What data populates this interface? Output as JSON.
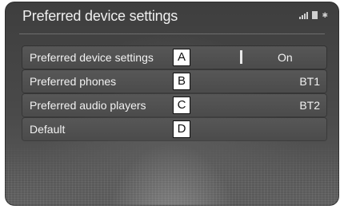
{
  "screen": {
    "title": "Preferred device settings"
  },
  "status_bar": {
    "icons": [
      "signal-icon",
      "battery-icon",
      "bluetooth-icon"
    ],
    "bluetooth_glyph": "✱"
  },
  "rows": [
    {
      "label": "Preferred device settings",
      "callout": "A",
      "toggle_label": "On",
      "toggle_state": "on"
    },
    {
      "label": "Preferred phones",
      "callout": "B",
      "value": "BT1"
    },
    {
      "label": "Preferred audio players",
      "callout": "C",
      "value": "BT2"
    },
    {
      "label": "Default",
      "callout": "D",
      "value": ""
    }
  ],
  "colors": {
    "text": "#f2f2f2",
    "row_background": "#525252",
    "callout_background": "#ffffff"
  }
}
